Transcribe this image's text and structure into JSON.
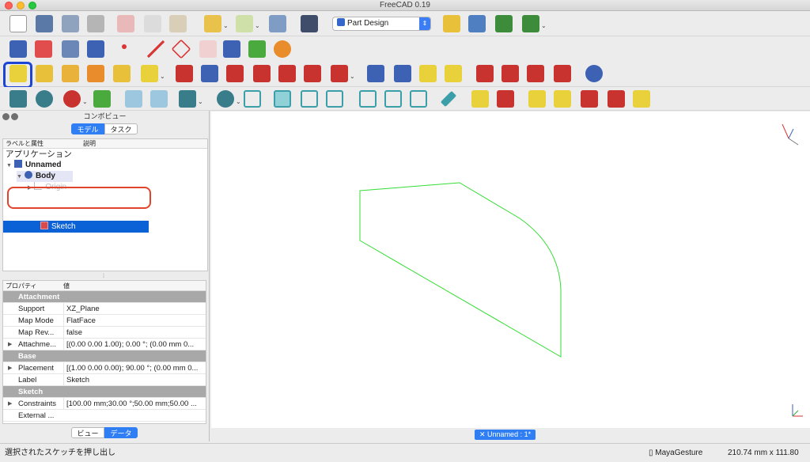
{
  "window": {
    "title": "FreeCAD 0.19"
  },
  "toolbar": {
    "workbench_selector": {
      "selected": "Part Design"
    }
  },
  "combo_view": {
    "title": "コンボビュー",
    "tabs": [
      {
        "label": "モデル",
        "active": true
      },
      {
        "label": "タスク",
        "active": false
      }
    ],
    "tree_columns": [
      "ラベルと属性",
      "説明"
    ],
    "tree": {
      "root": "アプリケーション",
      "document": "Unnamed",
      "body": "Body",
      "origin": "Origin",
      "sketch": "Sketch"
    },
    "property_columns": [
      "プロパティ",
      "値"
    ],
    "property_groups": [
      {
        "name": "Attachment",
        "rows": [
          {
            "key": "Support",
            "value": "XZ_Plane",
            "expandable": false
          },
          {
            "key": "Map Mode",
            "value": "FlatFace",
            "expandable": false
          },
          {
            "key": "Map Rev...",
            "value": "false",
            "expandable": false
          },
          {
            "key": "Attachme...",
            "value": "[(0.00 0.00 1.00); 0.00 °; (0.00 mm  0...",
            "expandable": true
          }
        ]
      },
      {
        "name": "Base",
        "rows": [
          {
            "key": "Placement",
            "value": "[(1.00 0.00 0.00); 90.00 °; (0.00 mm  0...",
            "expandable": true
          },
          {
            "key": "Label",
            "value": "Sketch",
            "expandable": false
          }
        ]
      },
      {
        "name": "Sketch",
        "rows": [
          {
            "key": "Constraints",
            "value": "[100.00 mm;30.00 °;50.00 mm;50.00 ...",
            "expandable": true
          },
          {
            "key": "External ...",
            "value": "",
            "expandable": false
          }
        ]
      }
    ],
    "bottom_tabs": [
      {
        "label": "ビュー",
        "active": false
      },
      {
        "label": "データ",
        "active": true
      }
    ]
  },
  "document_tab": {
    "label": "Unnamed : 1*"
  },
  "statusbar": {
    "message": "選択されたスケッチを押し出し",
    "navigation": "MayaGesture",
    "dimensions": "210.74 mm x 111.80 mm"
  },
  "colors": {
    "sketch_geometry": "#33dd33",
    "selection": "#0b62d6",
    "highlight_box": "#1c45d4",
    "annotation_ring": "#e0442c"
  }
}
